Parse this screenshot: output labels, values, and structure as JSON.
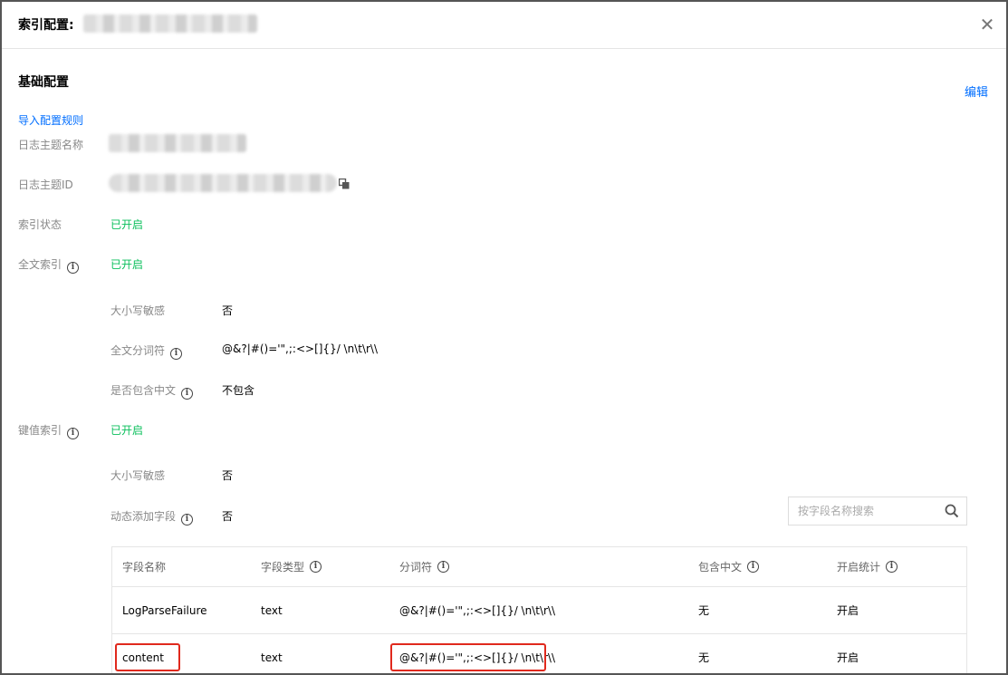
{
  "header": {
    "title": "索引配置:"
  },
  "section": {
    "title": "基础配置",
    "edit_label": "编辑",
    "import_label": "导入配置规则"
  },
  "fields": {
    "topic_name_label": "日志主题名称",
    "topic_id_label": "日志主题ID",
    "index_status_label": "索引状态",
    "index_status_value": "已开启",
    "fulltext_label": "全文索引",
    "fulltext_value": "已开启",
    "ft_case_label": "大小写敏感",
    "ft_case_value": "否",
    "ft_delim_label": "全文分词符",
    "ft_delim_value": "@&?|#()='\",;:<>[]{}/ \\n\\t\\r\\\\",
    "ft_chinese_label": "是否包含中文",
    "ft_chinese_value": "不包含",
    "kv_label": "键值索引",
    "kv_value": "已开启",
    "kv_case_label": "大小写敏感",
    "kv_case_value": "否",
    "kv_dynamic_label": "动态添加字段",
    "kv_dynamic_value": "否"
  },
  "search": {
    "placeholder": "按字段名称搜索"
  },
  "table": {
    "headers": [
      "字段名称",
      "字段类型",
      "分词符",
      "包含中文",
      "开启统计"
    ],
    "rows": [
      [
        "LogParseFailure",
        "text",
        "@&?|#()='\",;:<>[]{}/ \\n\\t\\r\\\\",
        "无",
        "开启"
      ],
      [
        "content",
        "text",
        "@&?|#()='\",;:<>[]{}/ \\n\\t\\r\\\\",
        "无",
        "开启"
      ]
    ]
  },
  "colors": {
    "link": "#006eff",
    "enabled": "#0abf5b",
    "highlight": "#e0291d"
  },
  "icons": [
    "close-icon",
    "info-icon",
    "copy-icon",
    "search-icon"
  ]
}
